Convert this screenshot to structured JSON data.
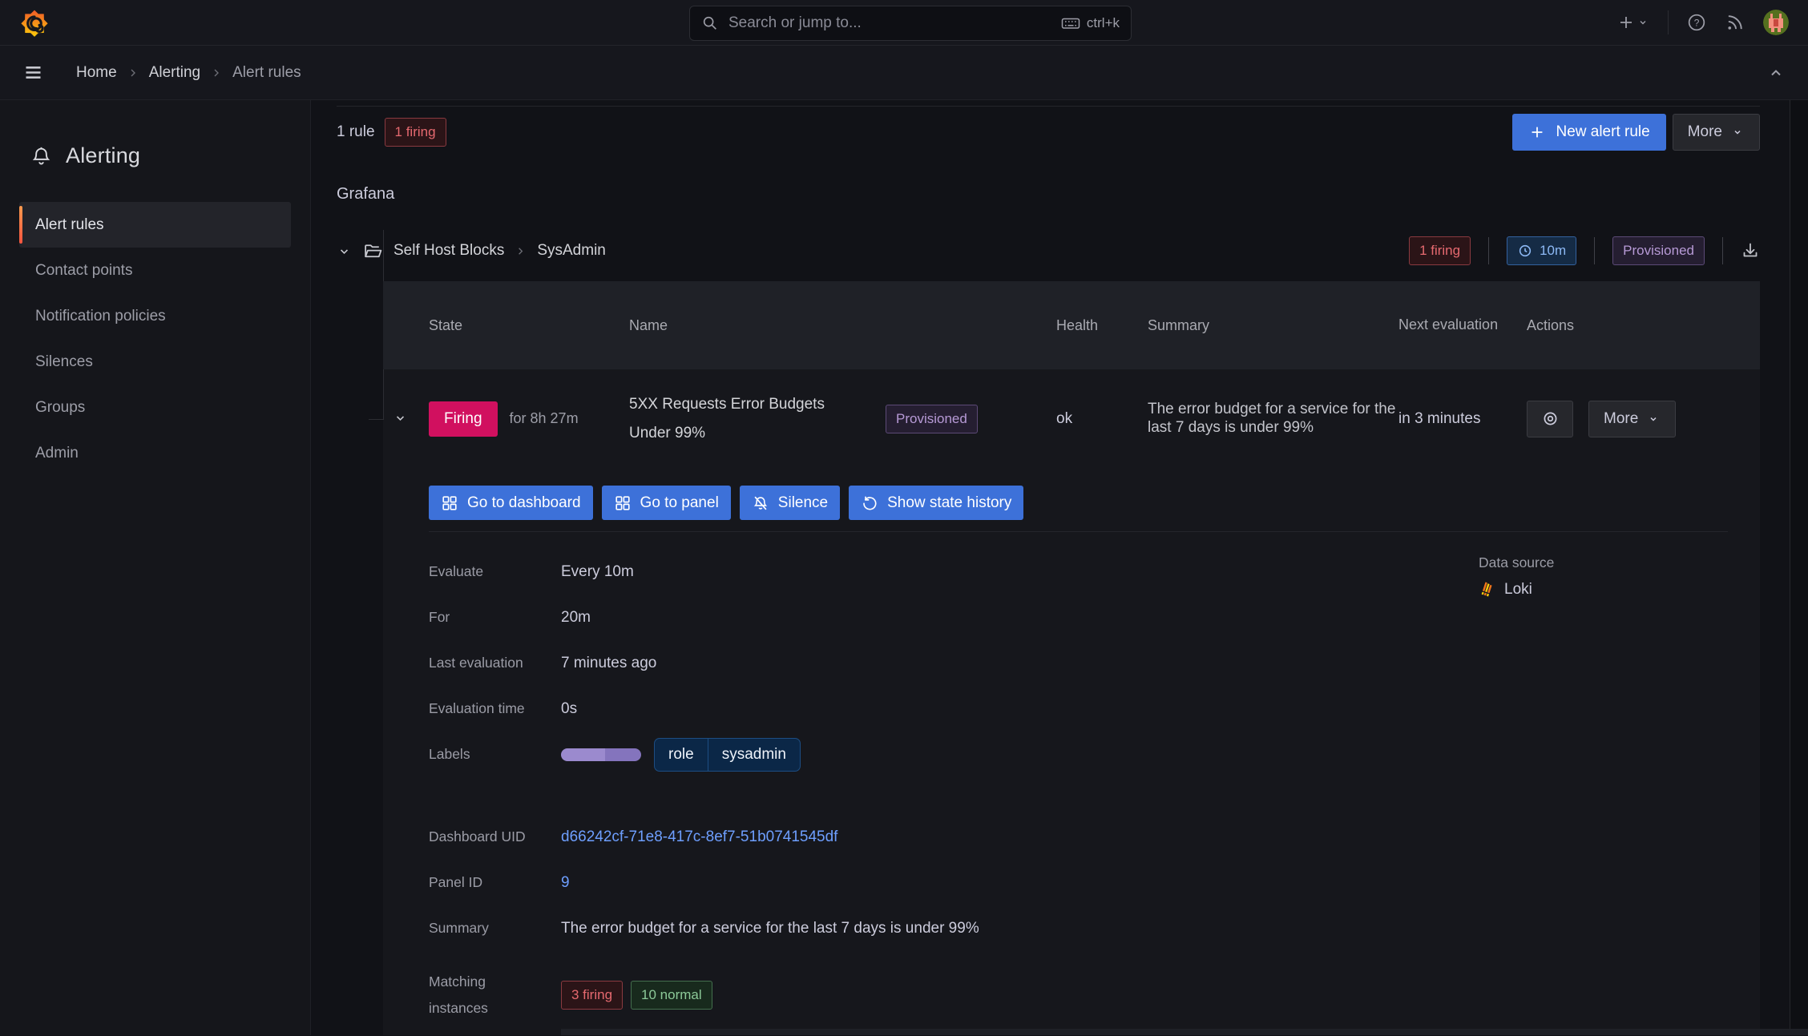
{
  "topbar": {
    "search_placeholder": "Search or jump to...",
    "shortcut": "ctrl+k"
  },
  "breadcrumb": {
    "home": "Home",
    "alerting": "Alerting",
    "alert_rules": "Alert rules"
  },
  "sidebar": {
    "title": "Alerting",
    "items": [
      {
        "label": "Alert rules"
      },
      {
        "label": "Contact points"
      },
      {
        "label": "Notification policies"
      },
      {
        "label": "Silences"
      },
      {
        "label": "Groups"
      },
      {
        "label": "Admin"
      }
    ]
  },
  "rules_header": {
    "count": "1 rule",
    "firing_badge": "1 firing",
    "new_button": "New alert rule",
    "more_button": "More"
  },
  "group": {
    "section": "Grafana",
    "folder": "Self Host Blocks",
    "subfolder": "SysAdmin",
    "firing_badge": "1 firing",
    "interval": "10m",
    "provisioned": "Provisioned"
  },
  "table": {
    "headers": [
      "State",
      "Name",
      "Health",
      "Summary",
      "Next evaluation",
      "Actions"
    ],
    "row": {
      "state": "Firing",
      "duration": "for 8h 27m",
      "name": "5XX Requests Error Budgets Under 99%",
      "provisioned": "Provisioned",
      "health": "ok",
      "summary": "The error budget for a service for the last 7 days is under 99%",
      "next_eval": "in 3 minutes",
      "more": "More"
    }
  },
  "row_actions": {
    "dashboard": "Go to dashboard",
    "panel": "Go to panel",
    "silence": "Silence",
    "history": "Show state history"
  },
  "details": {
    "rows": [
      {
        "label": "Evaluate",
        "value": "Every 10m"
      },
      {
        "label": "For",
        "value": "20m"
      },
      {
        "label": "Last evaluation",
        "value": "7 minutes ago"
      },
      {
        "label": "Evaluation time",
        "value": "0s"
      }
    ],
    "labels_label": "Labels",
    "label_key": "role",
    "label_value": "sysadmin",
    "datasource_label": "Data source",
    "datasource": "Loki",
    "uid_label": "Dashboard UID",
    "uid": "d66242cf-71e8-417c-8ef7-51b0741545df",
    "panel_label": "Panel ID",
    "panel_id": "9",
    "summary_label": "Summary",
    "summary": "The error budget for a service for the last 7 days is under 99%",
    "matching_label": "Matching instances",
    "firing_count": "3 firing",
    "normal_count": "10 normal"
  },
  "colors": {
    "accent_blue": "#3d71d9",
    "link_blue": "#6e9fff",
    "firing_pink": "#d1105f",
    "firing_red_badge": "#e5696f",
    "normal_green_badge": "#8cc998",
    "provisioned_purple": "#b79ad6",
    "active_orange": "#f5543f",
    "background": "#111217"
  }
}
